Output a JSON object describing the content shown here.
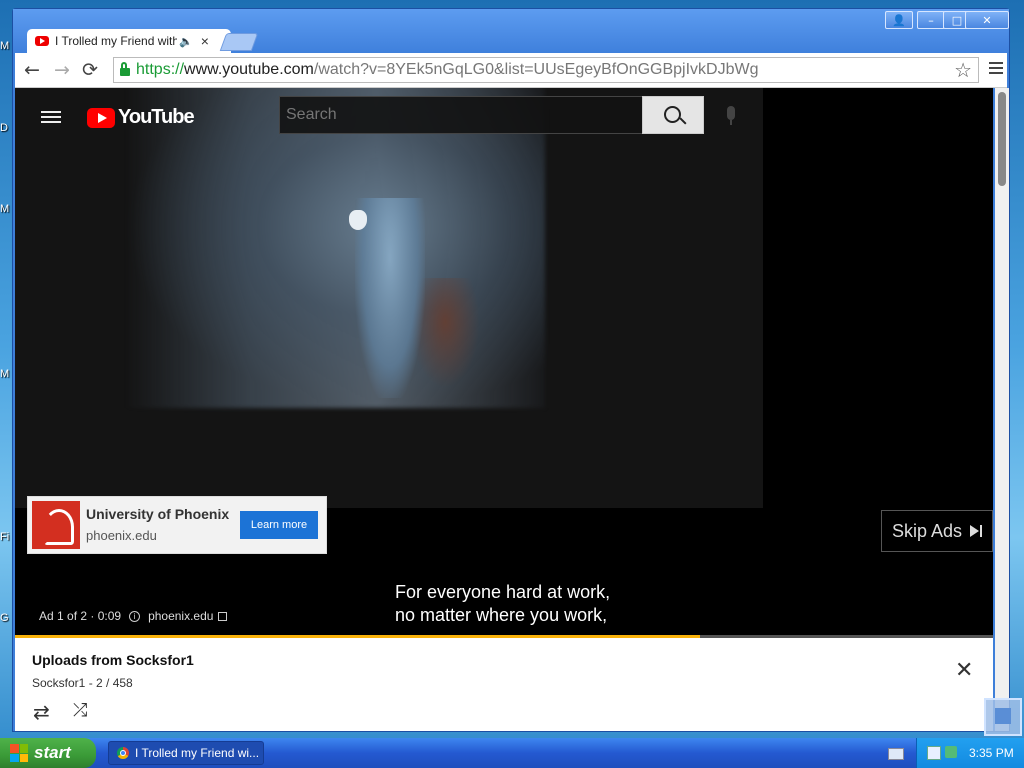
{
  "window": {
    "tab_title": "I Trolled my Friend with M",
    "tab_close": "×",
    "speaker_icon": "🔈",
    "controls": {
      "user": "👤",
      "minimize": "–",
      "maximize": "□",
      "close": "✕"
    }
  },
  "toolbar": {
    "back": "←",
    "forward": "→",
    "reload": "⟳",
    "url_scheme": "https://",
    "url_host": "www.youtube.com",
    "url_rest": "/watch?v=8YEk5nGqLG0&list=UUsEgeyBfOnGGBpjIvkDJbWg",
    "star": "☆"
  },
  "youtube": {
    "logo_text": "YouTube",
    "search_placeholder": "Search"
  },
  "ad": {
    "advertiser": "University of Phoenix",
    "domain": "phoenix.edu",
    "cta": "Learn more",
    "skip_label": "Skip Ads",
    "info_prefix": "Ad 1 of 2 · 0:09",
    "info_domain": "phoenix.edu",
    "progress": 0.7
  },
  "subtitle": {
    "line1": "For everyone hard at work,",
    "line2": "no matter where you work,"
  },
  "playlist": {
    "title": "Uploads from Socksfor1",
    "subtitle": "Socksfor1 - 2 / 458",
    "close": "✕",
    "loop_icon": "⇄",
    "shuffle_icon": "⤮"
  },
  "taskbar": {
    "start_label": "start",
    "task_label": "I Trolled my Friend wi...",
    "clock": "3:35 PM"
  },
  "desktop_fragments": [
    "M",
    "D",
    "M",
    "M",
    "Fi",
    "G"
  ],
  "colors": {
    "youtube_red": "#ff0000",
    "progress": "#f9b20a",
    "learn_more": "#1c73d6",
    "ad_logo": "#d32f20"
  }
}
